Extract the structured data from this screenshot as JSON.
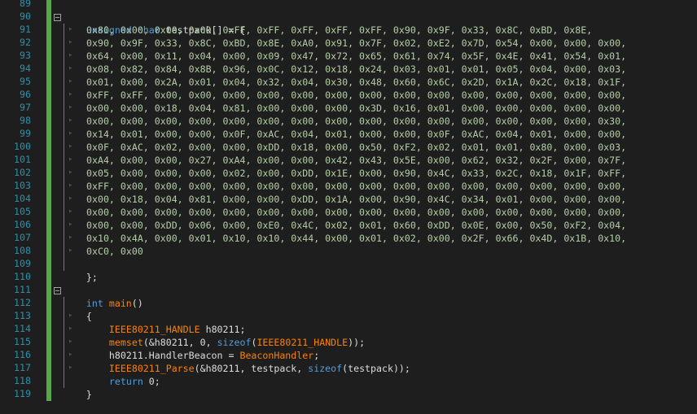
{
  "editor": {
    "line_numbers": [
      "89",
      "90",
      "91",
      "92",
      "93",
      "94",
      "95",
      "96",
      "97",
      "98",
      "99",
      "100",
      "101",
      "102",
      "103",
      "104",
      "105",
      "106",
      "107",
      "108",
      "109",
      "110",
      "111",
      "112",
      "113",
      "114",
      "115",
      "116",
      "117",
      "118",
      "119"
    ],
    "decl": {
      "kw1": "unsigned",
      "kw2": "char",
      "rest": " testpack[] = {"
    },
    "byte_rows": [
      "0x80, 0x00, 0x00, 0x00, 0xFF, 0xFF, 0xFF, 0xFF, 0xFF, 0x90, 0x9F, 0x33, 0x8C, 0xBD, 0x8E,",
      "0x90, 0x9F, 0x33, 0x8C, 0xBD, 0x8E, 0xA0, 0x91, 0x7F, 0x02, 0xE2, 0x7D, 0x54, 0x00, 0x00, 0x00,",
      "0x64, 0x00, 0x11, 0x04, 0x00, 0x09, 0x47, 0x72, 0x65, 0x61, 0x74, 0x5F, 0x4E, 0x41, 0x54, 0x01,",
      "0x08, 0x82, 0x84, 0x8B, 0x96, 0x0C, 0x12, 0x18, 0x24, 0x03, 0x01, 0x01, 0x05, 0x04, 0x00, 0x03,",
      "0x01, 0x00, 0x2A, 0x01, 0x04, 0x32, 0x04, 0x30, 0x48, 0x60, 0x6C, 0x2D, 0x1A, 0x2C, 0x18, 0x1F,",
      "0xFF, 0xFF, 0x00, 0x00, 0x00, 0x00, 0x00, 0x00, 0x00, 0x00, 0x00, 0x00, 0x00, 0x00, 0x00, 0x00,",
      "0x00, 0x00, 0x18, 0x04, 0x81, 0x00, 0x00, 0x00, 0x3D, 0x16, 0x01, 0x00, 0x00, 0x00, 0x00, 0x00,",
      "0x00, 0x00, 0x00, 0x00, 0x00, 0x00, 0x00, 0x00, 0x00, 0x00, 0x00, 0x00, 0x00, 0x00, 0x00, 0x30,",
      "0x14, 0x01, 0x00, 0x00, 0x0F, 0xAC, 0x04, 0x01, 0x00, 0x00, 0x0F, 0xAC, 0x04, 0x01, 0x00, 0x00,",
      "0x0F, 0xAC, 0x02, 0x00, 0x00, 0xDD, 0x18, 0x00, 0x50, 0xF2, 0x02, 0x01, 0x01, 0x80, 0x00, 0x03,",
      "0xA4, 0x00, 0x00, 0x27, 0xA4, 0x00, 0x00, 0x42, 0x43, 0x5E, 0x00, 0x62, 0x32, 0x2F, 0x00, 0x7F,",
      "0x05, 0x00, 0x00, 0x00, 0x02, 0x00, 0xDD, 0x1E, 0x00, 0x90, 0x4C, 0x33, 0x2C, 0x18, 0x1F, 0xFF,",
      "0xFF, 0x00, 0x00, 0x00, 0x00, 0x00, 0x00, 0x00, 0x00, 0x00, 0x00, 0x00, 0x00, 0x00, 0x00, 0x00,",
      "0x00, 0x18, 0x04, 0x81, 0x00, 0x00, 0xDD, 0x1A, 0x00, 0x90, 0x4C, 0x34, 0x01, 0x00, 0x00, 0x00,",
      "0x00, 0x00, 0x00, 0x00, 0x00, 0x00, 0x00, 0x00, 0x00, 0x00, 0x00, 0x00, 0x00, 0x00, 0x00, 0x00,",
      "0x00, 0x00, 0xDD, 0x06, 0x00, 0xE0, 0x4C, 0x02, 0x01, 0x60, 0xDD, 0x0E, 0x00, 0x50, 0xF2, 0x04,",
      "0x10, 0x4A, 0x00, 0x01, 0x10, 0x10, 0x44, 0x00, 0x01, 0x02, 0x00, 0x2F, 0x66, 0x4D, 0x1B, 0x10,",
      "0xC0, 0x00"
    ],
    "close_decl": "};",
    "main_sig": {
      "kw": "int",
      "name": "main",
      "paren": "()"
    },
    "open_brace": "{",
    "close_brace": "}",
    "stmt1": {
      "type": "IEEE80211_HANDLE",
      "rest": " h80211;"
    },
    "stmt2": {
      "fn": "memset",
      "a": "(&h80211, 0, ",
      "kw": "sizeof",
      "b": "(",
      "type": "IEEE80211_HANDLE",
      "c": "));"
    },
    "stmt3": {
      "a": "h80211.HandlerBeacon = ",
      "fn": "BeaconHandler",
      "b": ";"
    },
    "stmt4": {
      "fn": "IEEE80211_Parse",
      "a": "(&h80211, testpack, ",
      "kw": "sizeof",
      "b": "(testpack));"
    },
    "stmt5": {
      "kw": "return",
      "rest": " 0;"
    }
  },
  "colors": {
    "background": "#1e1e1e",
    "line_number": "#2b91af",
    "keyword": "#569cd6",
    "function": "#ff8000",
    "number": "#b5cea8",
    "change_bar": "#57a64a"
  }
}
